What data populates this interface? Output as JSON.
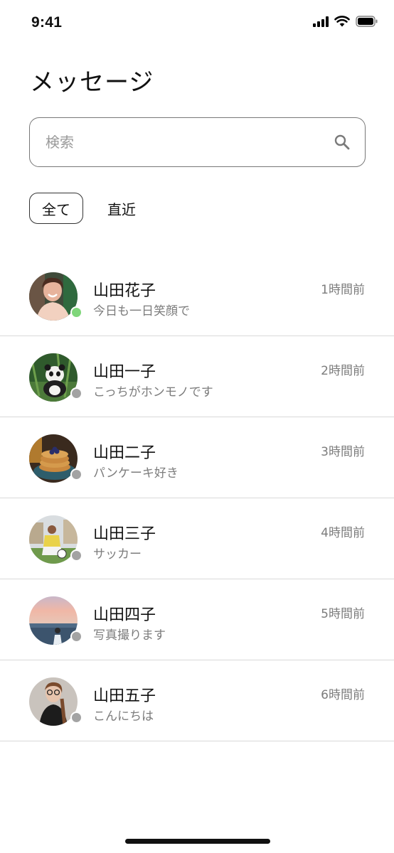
{
  "status_bar": {
    "time": "9:41"
  },
  "header": {
    "title": "メッセージ"
  },
  "search": {
    "placeholder": "検索",
    "value": ""
  },
  "filters": [
    {
      "label": "全て",
      "selected": true
    },
    {
      "label": "直近",
      "selected": false
    }
  ],
  "colors": {
    "online": "#7fd67a",
    "offline": "#a3a3a3"
  },
  "messages": [
    {
      "name": "山田花子",
      "preview": "今日も一日笑顔で",
      "time": "1時間前",
      "online": true
    },
    {
      "name": "山田一子",
      "preview": "こっちがホンモノです",
      "time": "2時間前",
      "online": false
    },
    {
      "name": "山田二子",
      "preview": "パンケーキ好き",
      "time": "3時間前",
      "online": false
    },
    {
      "name": "山田三子",
      "preview": "サッカー",
      "time": "4時間前",
      "online": false
    },
    {
      "name": "山田四子",
      "preview": "写真撮ります",
      "time": "5時間前",
      "online": false
    },
    {
      "name": "山田五子",
      "preview": "こんにちは",
      "time": "6時間前",
      "online": false
    }
  ]
}
